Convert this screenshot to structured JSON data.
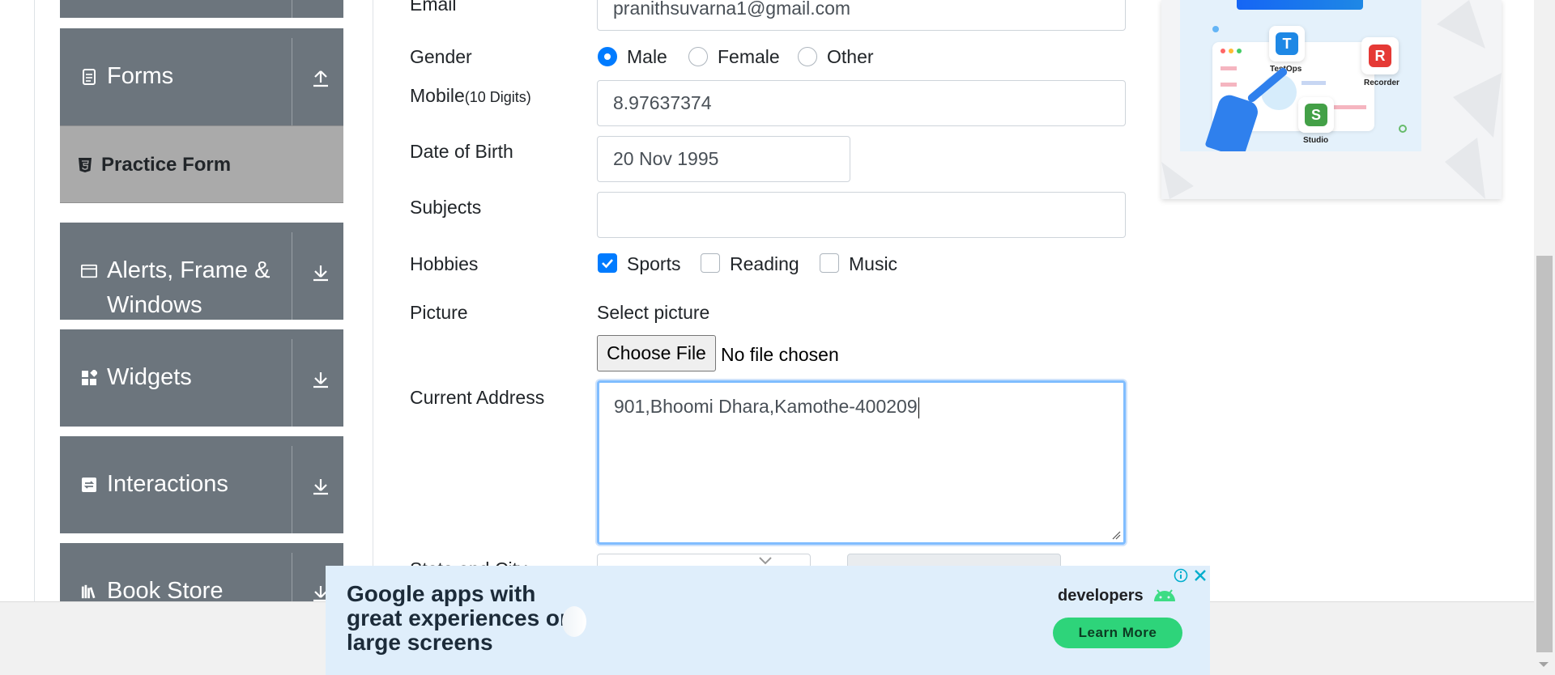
{
  "sidebar": {
    "groups": [
      {
        "label": "Forms",
        "icon": "document-icon"
      },
      {
        "label": "Alerts, Frame & Windows",
        "icon": "window-icon"
      },
      {
        "label": "Widgets",
        "icon": "widgets-icon"
      },
      {
        "label": "Interactions",
        "icon": "interactions-icon"
      },
      {
        "label": "Book Store",
        "icon": "books-icon"
      }
    ],
    "active_item": "Practice Form"
  },
  "form": {
    "email_label": "Email",
    "email_value": "pranithsuvarna1@gmail.com",
    "gender_label": "Gender",
    "gender_options": [
      "Male",
      "Female",
      "Other"
    ],
    "gender_selected": "Male",
    "mobile_label": "Mobile",
    "mobile_hint": "(10 Digits)",
    "mobile_value": "8.97637374",
    "dob_label": "Date of Birth",
    "dob_value": "20 Nov 1995",
    "subjects_label": "Subjects",
    "subjects_value": "",
    "hobbies_label": "Hobbies",
    "hobbies_options": [
      "Sports",
      "Reading",
      "Music"
    ],
    "hobbies_checked": [
      "Sports"
    ],
    "picture_label": "Picture",
    "select_picture": "Select picture",
    "choose_file": "Choose File",
    "no_file": "No file chosen",
    "address_label": "Current Address",
    "address_value": "901,Bhoomi Dhara,Kamothe-400209",
    "state_city_label": "State and City"
  },
  "ad_right": {
    "badges": [
      "TestOps",
      "Recorder",
      "Studio"
    ]
  },
  "ad_bottom": {
    "headline": "Google apps with great experiences on large screens",
    "brand": "developers",
    "cta": "Learn More"
  },
  "colors": {
    "sidebar_group": "#6c757d",
    "sidebar_active": "#aaaaaa",
    "primary": "#007bff",
    "focus_border": "#80bdff",
    "ad_bg": "#dfeefb",
    "cta": "#2ed47a"
  }
}
